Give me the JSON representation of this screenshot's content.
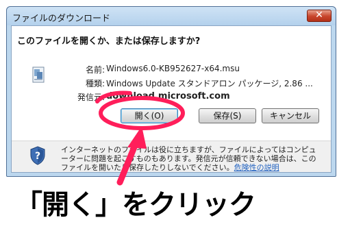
{
  "window": {
    "title": "ファイルのダウンロード",
    "close_glyph": "✕"
  },
  "dialog": {
    "question": "このファイルを開くか、または保存しますか?",
    "file": {
      "name_label": "名前:",
      "name_value": "Windows6.0-KB952627-x64.msu",
      "type_label": "種類:",
      "type_value": "Windows Update スタンドアロン パッケージ, 2.86 ...",
      "from_label": "発信元:",
      "from_value": "download.microsoft.com"
    },
    "buttons": {
      "open": "開く(O)",
      "save": "保存(S)",
      "cancel": "キャンセル"
    },
    "warning": {
      "text": "インターネットのファイルは役に立ちますが、ファイルによってはコンピューターに問題を起こすものもあります。発信元が信頼できない場合は、このファイルを開いたり保存したりしないでください。",
      "link": "危険性の説明"
    }
  },
  "annotation": {
    "text": "「開く」をクリック",
    "highlight_color": "#ff1e5a"
  },
  "icons": {
    "file": "msu-package-icon",
    "shield": "security-shield-icon"
  }
}
